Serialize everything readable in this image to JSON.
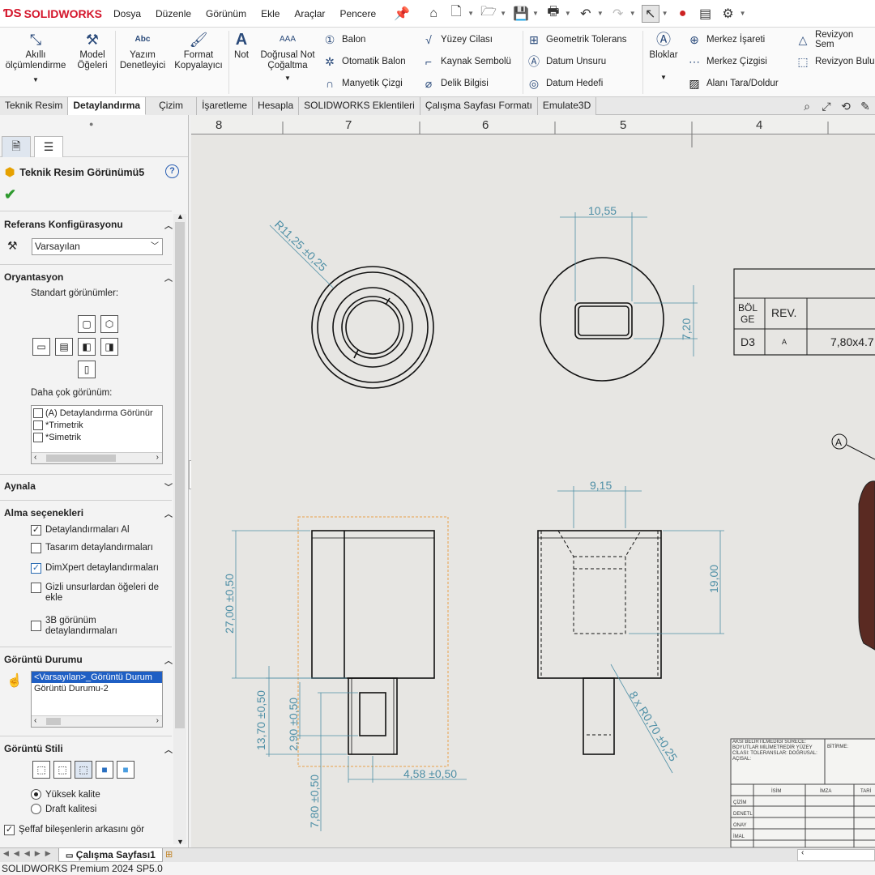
{
  "app": {
    "logo": "SOLIDWORKS",
    "menu": [
      "Dosya",
      "Düzenle",
      "Görünüm",
      "Ekle",
      "Araçlar",
      "Pencere"
    ]
  },
  "ribbon": {
    "smart_dim": "Akıllı ölçümlendirme",
    "model_items": "Model Öğeleri",
    "spell": "Yazım Denetleyici",
    "format": "Format Kopyalayıcı",
    "note": "Not",
    "linear_note": "Doğrusal Not Çoğaltma",
    "balloon": "Balon",
    "auto_balloon": "Otomatik Balon",
    "magnetic_line": "Manyetik Çizgi",
    "surface_finish": "Yüzey Cilası",
    "weld_symbol": "Kaynak Sembolü",
    "hole_callout": "Delik Bilgisi",
    "geo_tol": "Geometrik Tolerans",
    "datum_feature": "Datum Unsuru",
    "datum_target": "Datum Hedefi",
    "blocks": "Bloklar",
    "center_mark": "Merkez İşareti",
    "center_line": "Merkez Çizgisi",
    "area_hatch": "Alanı Tara/Doldur",
    "revision_symbol": "Revizyon Sem",
    "revision_cloud": "Revizyon Bulu",
    "abc": "Abc"
  },
  "tabs": [
    "Teknik Resim",
    "Detaylandırma",
    "Çizim",
    "İşaretleme",
    "Hesapla",
    "SOLIDWORKS Eklentileri",
    "Çalışma Sayfası Formatı",
    "Emulate3D"
  ],
  "pm": {
    "title": "Teknik Resim Görünümü5",
    "help": "?",
    "ref_config_header": "Referans Konfigürasyonu",
    "ref_config_value": "Varsayılan",
    "orientation_header": "Oryantasyon",
    "standard_views": "Standart görünümler:",
    "more_views": "Daha çok görünüm:",
    "more_views_items": [
      "(A) Detaylandırma Görünür",
      "*Trimetrik",
      "*Simetrik"
    ],
    "mirror_header": "Aynala",
    "import_header": "Alma seçenekleri",
    "import_options": [
      {
        "label": "Detaylandırmaları Al",
        "checked": true
      },
      {
        "label": "Tasarım detaylandırmaları",
        "checked": false
      },
      {
        "label": "DimXpert detaylandırmaları",
        "checked": true
      },
      {
        "label": "Gizli unsurlardan öğeleri de ekle",
        "checked": false
      },
      {
        "label": "3B görünüm detaylandırmaları",
        "checked": false
      }
    ],
    "display_state_header": "Görüntü Durumu",
    "display_states": [
      "<Varsayılan>_Görüntü Durum",
      "Görüntü Durumu-2"
    ],
    "display_style_header": "Görüntü Stili",
    "quality_high": "Yüksek kalite",
    "quality_draft": "Draft kalitesi",
    "transparent": "Şeffaf bileşenlerin arkasını gör"
  },
  "ruler": [
    "8",
    "7",
    "6",
    "5",
    "4"
  ],
  "drawing": {
    "dims": {
      "r_top": "R11,25 ±0,25",
      "w_top": "10,55",
      "h_top": "7,20",
      "w_right": "9,15",
      "h_right": "19,00",
      "h_left_main": "27,00 ±0,50",
      "h_left_a": "13,70 ±0,50",
      "h_left_b": "2,90 ±0,50",
      "h_left_c": "7,80 ±0,50",
      "w_bottom": "4,58 ±0,50",
      "r_small": "8 x R0,70 ±0,25"
    },
    "detail_label": "A",
    "rev_table": {
      "col1": "BÖL GE",
      "col2": "REV.",
      "row_zone": "D3",
      "row_rev": "A",
      "row_desc": "7,80x4.7"
    },
    "title_block": {
      "notes": "AKSİ BELİRTİLMEDİĞİ SÜRECE: BOYUTLAR MİLİMETREDİR YÜZEY CİLASI: TOLERANSLAR: DOĞRUSAL: AÇISAL:",
      "finish": "BİTİRME:",
      "col_name": "İSİM",
      "col_sign": "İMZA",
      "col_date": "TARİ",
      "rows": [
        "ÇİZİM",
        "DENETL",
        "ONAY",
        "İMAL"
      ]
    }
  },
  "sheet_tab": "Çalışma Sayfası1",
  "status": "SOLIDWORKS Premium 2024 SP5.0",
  "colors": {
    "dim": "#4e8fa6",
    "selection": "#e8a04a",
    "part": "#5a2a22"
  }
}
